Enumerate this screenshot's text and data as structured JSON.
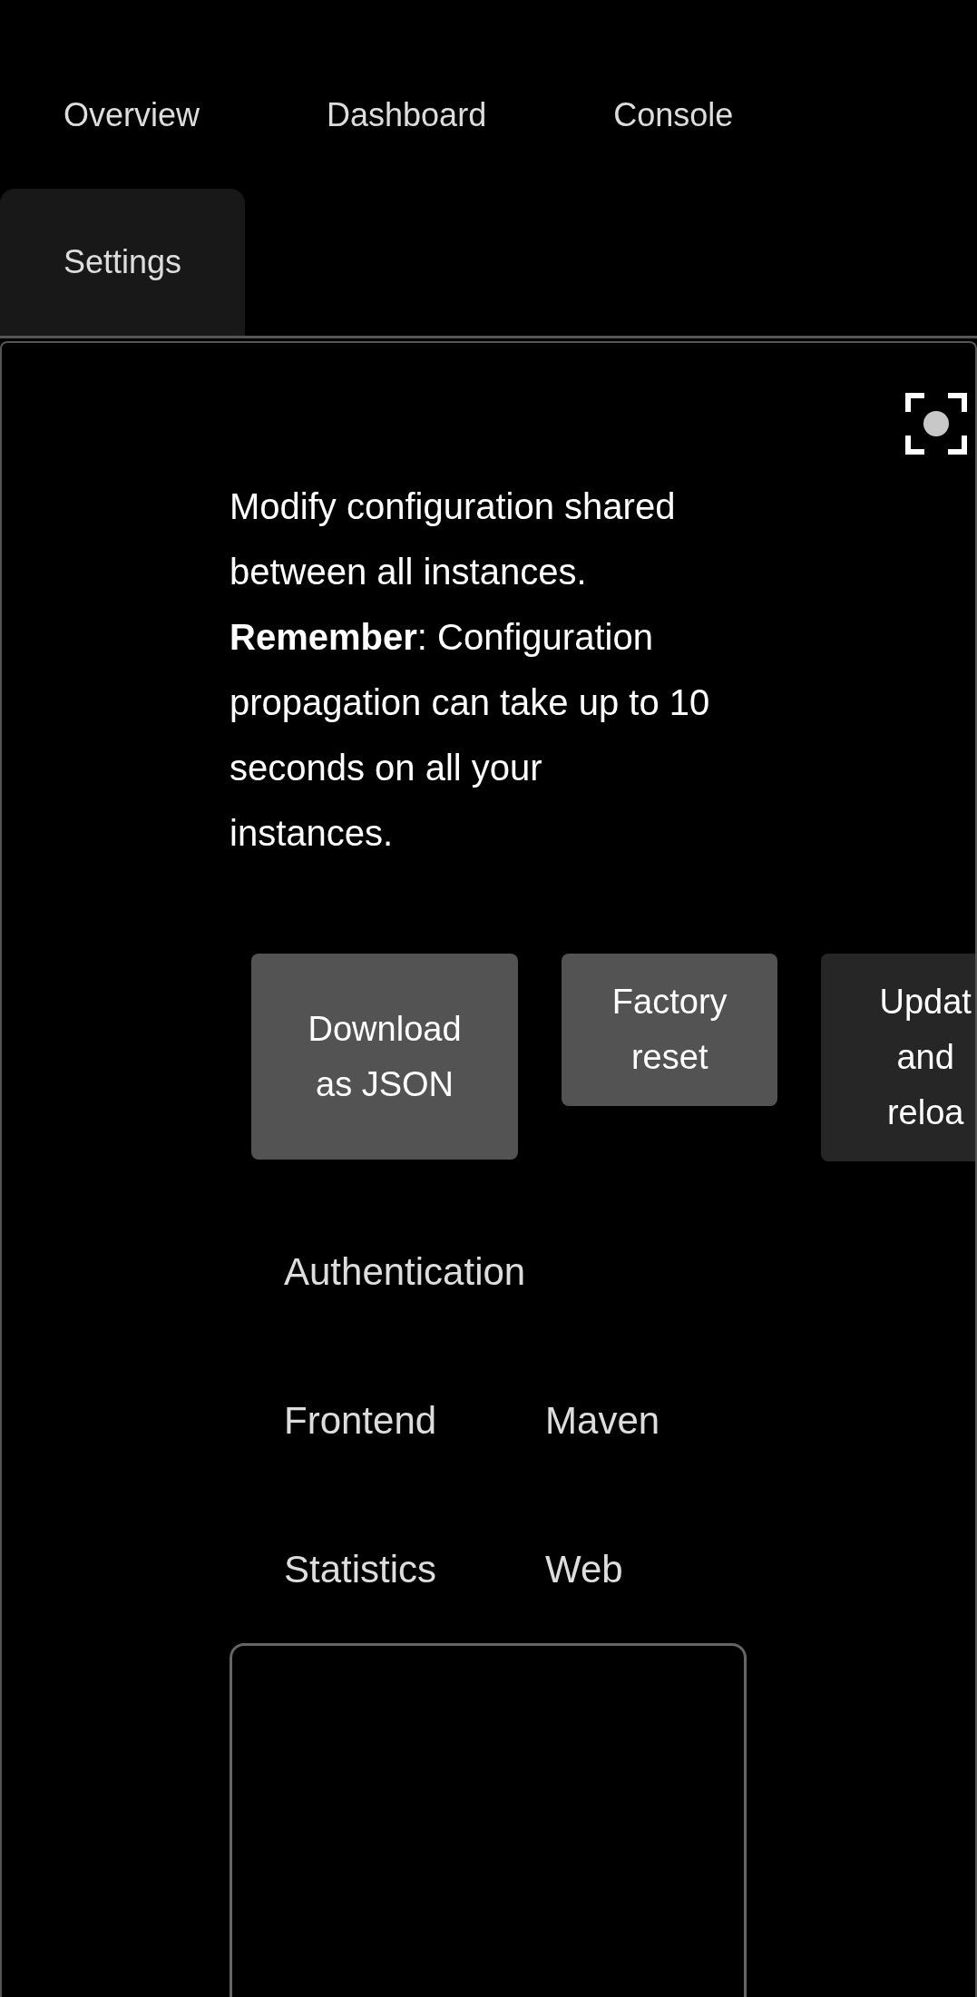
{
  "tabs": [
    {
      "label": "Overview",
      "selected": false
    },
    {
      "label": "Dashboard",
      "selected": false
    },
    {
      "label": "Console",
      "selected": false
    },
    {
      "label": "Settings",
      "selected": true
    }
  ],
  "description": [
    "Modify configuration shared between all instances.",
    "**Remember**: Configuration propagation can take up to 10 seconds on all your instances."
  ],
  "buttons": [
    {
      "kind": "primary",
      "lines": [
        "Download",
        "as JSON"
      ]
    },
    {
      "kind": "primary",
      "lines": [
        "Factory",
        "reset"
      ]
    },
    {
      "kind": "secondary",
      "lines": [
        "Updat",
        "and",
        "reloa"
      ]
    }
  ],
  "sections": [
    "Authentication",
    "Frontend",
    "Maven",
    "Statistics",
    "Web"
  ]
}
